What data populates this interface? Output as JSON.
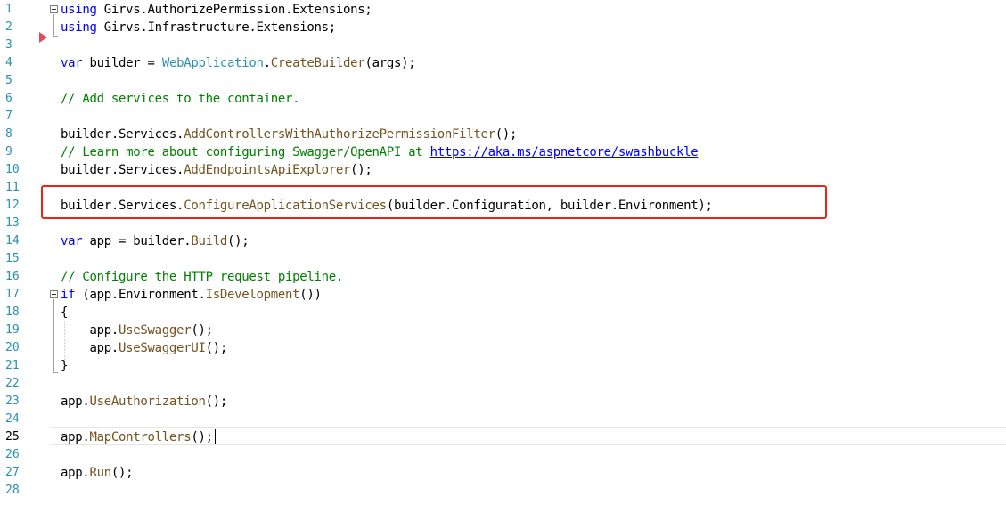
{
  "editor": {
    "current_line": 25,
    "lines": [
      {
        "n": "1",
        "tokens": [
          [
            "kw",
            "using"
          ],
          [
            "tok",
            " Girvs.AuthorizePermission.Extensions;"
          ]
        ]
      },
      {
        "n": "2",
        "tokens": [
          [
            "kw",
            "using"
          ],
          [
            "tok",
            " Girvs.Infrastructure.Extensions;"
          ]
        ]
      },
      {
        "n": "3",
        "tokens": []
      },
      {
        "n": "4",
        "tokens": [
          [
            "kw",
            "var"
          ],
          [
            "tok",
            " builder = "
          ],
          [
            "type",
            "WebApplication"
          ],
          [
            "tok",
            "."
          ],
          [
            "method",
            "CreateBuilder"
          ],
          [
            "tok",
            "(args);"
          ]
        ]
      },
      {
        "n": "5",
        "tokens": []
      },
      {
        "n": "6",
        "tokens": [
          [
            "cm",
            "// Add services to the container."
          ]
        ]
      },
      {
        "n": "7",
        "tokens": []
      },
      {
        "n": "8",
        "tokens": [
          [
            "tok",
            "builder.Services."
          ],
          [
            "method",
            "AddControllersWithAuthorizePermissionFilter"
          ],
          [
            "tok",
            "();"
          ]
        ]
      },
      {
        "n": "9",
        "tokens": [
          [
            "cm",
            "// Learn more about configuring Swagger/OpenAPI at "
          ],
          [
            "lnk",
            "https://aka.ms/aspnetcore/swashbuckle"
          ]
        ]
      },
      {
        "n": "10",
        "tokens": [
          [
            "tok",
            "builder.Services."
          ],
          [
            "method",
            "AddEndpointsApiExplorer"
          ],
          [
            "tok",
            "();"
          ]
        ]
      },
      {
        "n": "11",
        "tokens": []
      },
      {
        "n": "12",
        "tokens": [
          [
            "tok",
            "builder.Services."
          ],
          [
            "method",
            "ConfigureApplicationServices"
          ],
          [
            "tok",
            "(builder.Configuration, builder.Environment);"
          ]
        ]
      },
      {
        "n": "13",
        "tokens": []
      },
      {
        "n": "14",
        "tokens": [
          [
            "kw",
            "var"
          ],
          [
            "tok",
            " app = builder."
          ],
          [
            "method",
            "Build"
          ],
          [
            "tok",
            "();"
          ]
        ]
      },
      {
        "n": "15",
        "tokens": []
      },
      {
        "n": "16",
        "tokens": [
          [
            "cm",
            "// Configure the HTTP request pipeline."
          ]
        ]
      },
      {
        "n": "17",
        "tokens": [
          [
            "kw",
            "if"
          ],
          [
            "tok",
            " (app.Environment."
          ],
          [
            "method",
            "IsDevelopment"
          ],
          [
            "tok",
            "())"
          ]
        ]
      },
      {
        "n": "18",
        "tokens": [
          [
            "tok",
            "{"
          ]
        ]
      },
      {
        "n": "19",
        "tokens": [
          [
            "tok",
            "    app."
          ],
          [
            "method",
            "UseSwagger"
          ],
          [
            "tok",
            "();"
          ]
        ]
      },
      {
        "n": "20",
        "tokens": [
          [
            "tok",
            "    app."
          ],
          [
            "method",
            "UseSwaggerUI"
          ],
          [
            "tok",
            "();"
          ]
        ]
      },
      {
        "n": "21",
        "tokens": [
          [
            "tok",
            "}"
          ]
        ]
      },
      {
        "n": "22",
        "tokens": []
      },
      {
        "n": "23",
        "tokens": [
          [
            "tok",
            "app."
          ],
          [
            "method",
            "UseAuthorization"
          ],
          [
            "tok",
            "();"
          ]
        ]
      },
      {
        "n": "24",
        "tokens": []
      },
      {
        "n": "25",
        "tokens": [
          [
            "tok",
            "app."
          ],
          [
            "method",
            "MapControllers"
          ],
          [
            "tok",
            "();"
          ]
        ]
      },
      {
        "n": "26",
        "tokens": []
      },
      {
        "n": "27",
        "tokens": [
          [
            "tok",
            "app."
          ],
          [
            "method",
            "Run"
          ],
          [
            "tok",
            "();"
          ]
        ]
      },
      {
        "n": "28",
        "tokens": []
      }
    ]
  },
  "colors": {
    "keyword": "#0000ff",
    "type": "#2b91af",
    "method": "#74531f",
    "comment": "#008000",
    "line_number": "#2b91af",
    "highlight_box": "#e8231c",
    "breakpoint_arrow": "#e04b5a"
  },
  "icons": {
    "collapse": "collapse-minus-icon",
    "execution_marker": "execution-arrow-icon"
  }
}
